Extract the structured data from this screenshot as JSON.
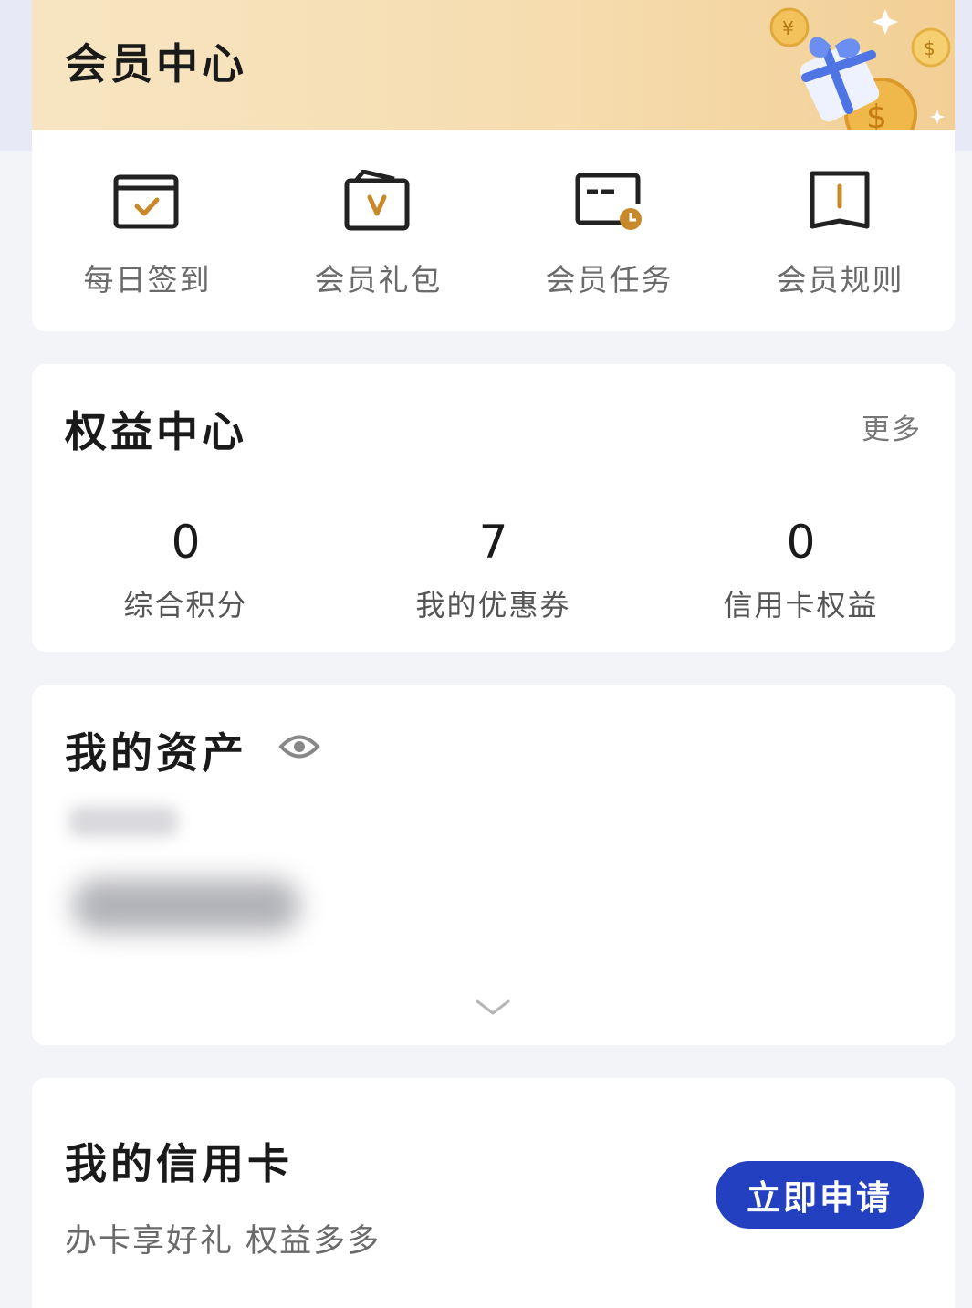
{
  "member_center": {
    "title": "会员中心",
    "shortcuts": [
      {
        "label": "每日签到",
        "icon": "calendar-check-icon"
      },
      {
        "label": "会员礼包",
        "icon": "gift-pack-icon"
      },
      {
        "label": "会员任务",
        "icon": "task-clock-icon"
      },
      {
        "label": "会员规则",
        "icon": "rule-book-icon"
      }
    ]
  },
  "benefits": {
    "title": "权益中心",
    "more_label": "更多",
    "stats": [
      {
        "value": "0",
        "label": "综合积分"
      },
      {
        "value": "7",
        "label": "我的优惠券"
      },
      {
        "value": "0",
        "label": "信用卡权益"
      }
    ]
  },
  "assets": {
    "title": "我的资产"
  },
  "credit_card": {
    "title": "我的信用卡",
    "subtitle": "办卡享好礼 权益多多",
    "apply_label": "立即申请"
  },
  "colors": {
    "accent_gold": "#c8892a",
    "primary_blue": "#2340c0",
    "header_gradient_start": "#f7e5c2",
    "header_gradient_end": "#f2cf95"
  }
}
